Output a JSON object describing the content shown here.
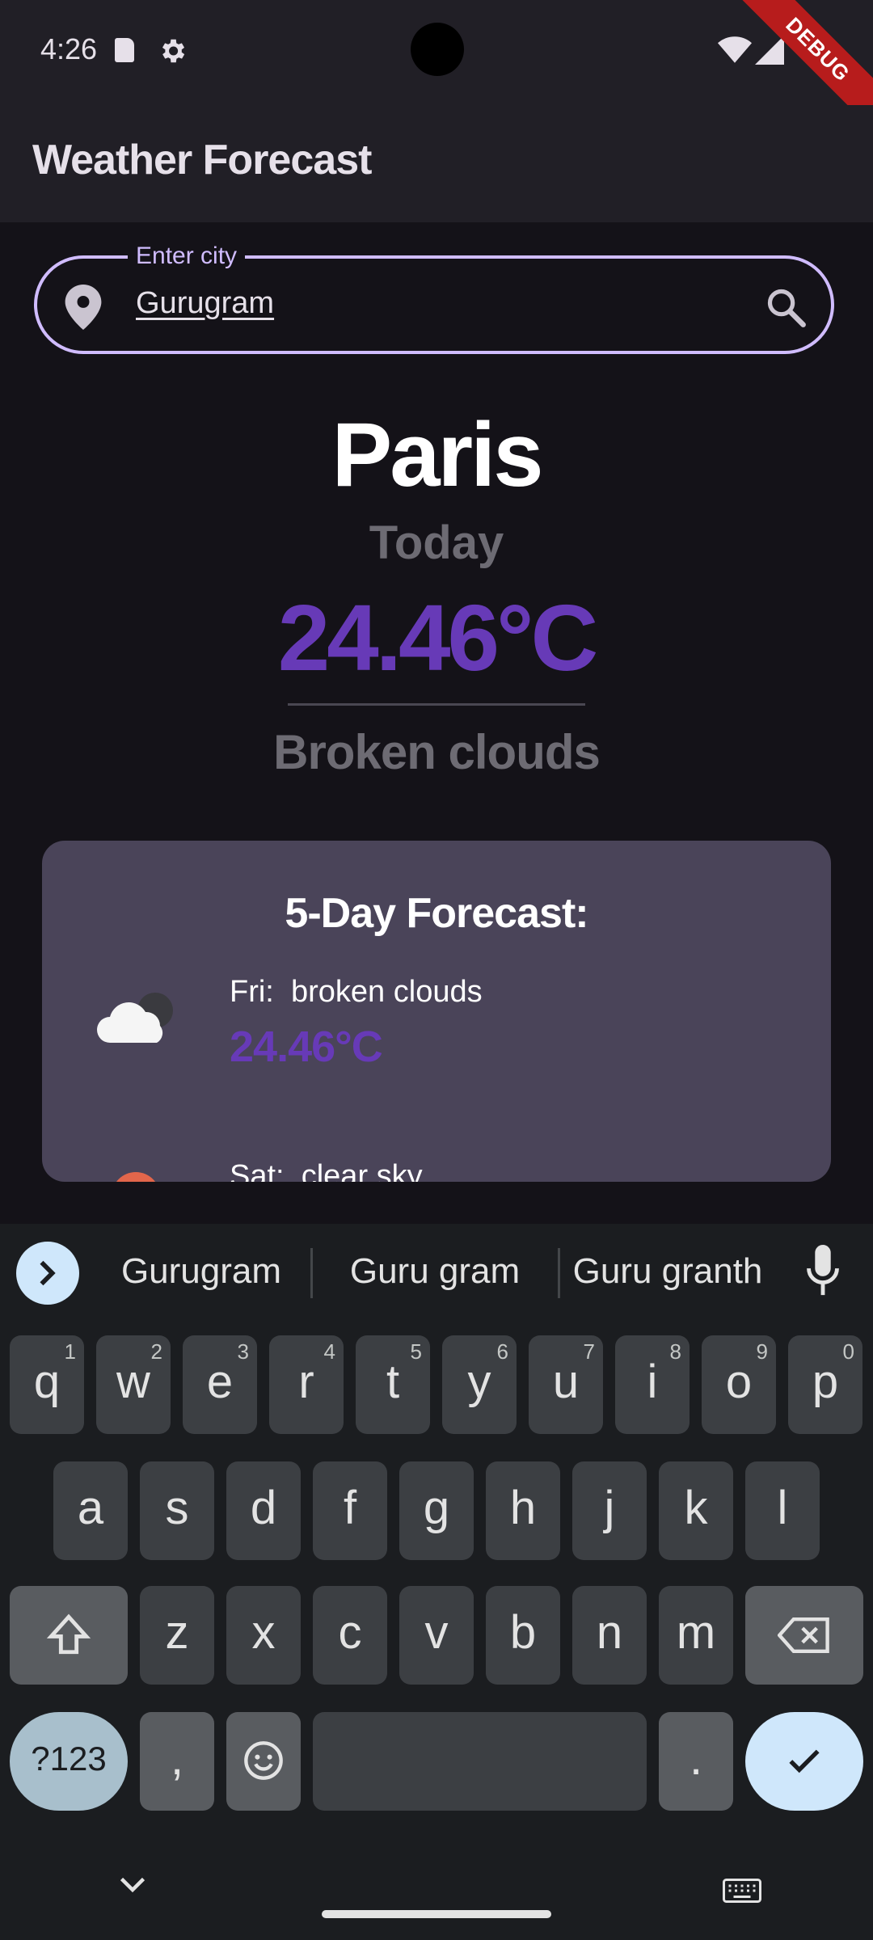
{
  "status_bar": {
    "time": "4:26",
    "debug_label": "DEBUG"
  },
  "app_bar": {
    "title": "Weather Forecast"
  },
  "search": {
    "label": "Enter city",
    "value": "Gurugram"
  },
  "current": {
    "city": "Paris",
    "day_label": "Today",
    "temperature": "24.46°C",
    "description": "Broken clouds"
  },
  "forecast": {
    "title": "5-Day Forecast:",
    "items": [
      {
        "day": "Fri:",
        "description": "broken clouds",
        "temperature": "24.46°C",
        "icon": "cloud-icon"
      },
      {
        "day": "Sat:",
        "description": "clear sky",
        "icon": "sun-icon"
      }
    ]
  },
  "keyboard": {
    "suggestions": [
      "Gurugram",
      "Guru gram",
      "Guru granth"
    ],
    "row1": [
      "q",
      "w",
      "e",
      "r",
      "t",
      "y",
      "u",
      "i",
      "o",
      "p"
    ],
    "row1_hints": [
      "1",
      "2",
      "3",
      "4",
      "5",
      "6",
      "7",
      "8",
      "9",
      "0"
    ],
    "row2": [
      "a",
      "s",
      "d",
      "f",
      "g",
      "h",
      "j",
      "k",
      "l"
    ],
    "row3": [
      "z",
      "x",
      "c",
      "v",
      "b",
      "n",
      "m"
    ],
    "symbols_label": "?123",
    "comma": ",",
    "period": "."
  },
  "colors": {
    "accent": "#d0bcff",
    "temperature": "#673ab7",
    "card": "#4a4459",
    "background": "#141218"
  }
}
